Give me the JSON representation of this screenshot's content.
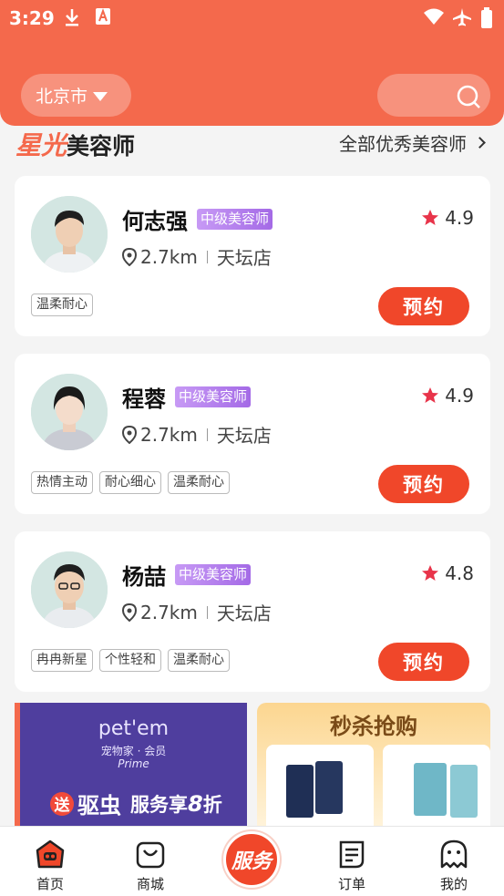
{
  "status_bar": {
    "time": "3:29"
  },
  "header": {
    "city": "北京市"
  },
  "section": {
    "title_accent": "星光",
    "title_rest": "美容师",
    "more_link": "全部优秀美容师"
  },
  "groomers": [
    {
      "name": "何志强",
      "level": "中级美容师",
      "rating": "4.9",
      "distance": "2.7km",
      "store": "天坛店",
      "tags": [
        "温柔耐心"
      ],
      "book_label": "预约"
    },
    {
      "name": "程蓉",
      "level": "中级美容师",
      "rating": "4.9",
      "distance": "2.7km",
      "store": "天坛店",
      "tags": [
        "热情主动",
        "耐心细心",
        "温柔耐心"
      ],
      "book_label": "预约"
    },
    {
      "name": "杨喆",
      "level": "中级美容师",
      "rating": "4.8",
      "distance": "2.7km",
      "store": "天坛店",
      "tags": [
        "冉冉新星",
        "个性轻和",
        "温柔耐心"
      ],
      "book_label": "预约"
    }
  ],
  "banners": {
    "left": {
      "brand": "pet'em",
      "brand_sub": "宠物家 · 会员",
      "brand_prime": "Prime",
      "badge": "送",
      "promo_main": "驱虫",
      "promo_text": "服务享",
      "promo_num": "8",
      "promo_unit": "折"
    },
    "right": {
      "title": "秒杀抢购"
    }
  },
  "tabbar": {
    "items": [
      {
        "label": "首页",
        "icon": "home-icon"
      },
      {
        "label": "商城",
        "icon": "shop-bag-icon"
      },
      {
        "label": "订单",
        "icon": "order-icon"
      },
      {
        "label": "我的",
        "icon": "profile-ghost-icon"
      }
    ],
    "center_label": "服务"
  },
  "colors": {
    "brand": "#f4694c",
    "button": "#f0472a",
    "level_badge": "#b07ef0",
    "star": "#e8344a"
  }
}
